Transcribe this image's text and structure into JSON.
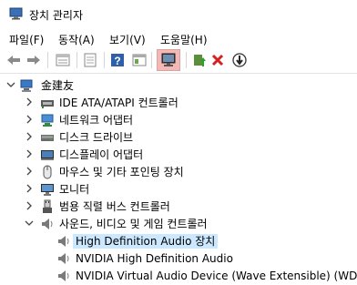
{
  "window": {
    "title": "장치 관리자"
  },
  "menu": {
    "items": [
      "파일(F)",
      "동작(A)",
      "보기(V)",
      "도움말(H)"
    ]
  },
  "toolbar": {
    "buttons": [
      "back-icon",
      "forward-icon",
      "properties-icon",
      "details-icon",
      "help-icon",
      "view-icon",
      "monitor-scan-icon",
      "update-driver-icon",
      "uninstall-icon",
      "disable-icon"
    ]
  },
  "tree": {
    "root": "金建友",
    "categories": [
      "IDE ATA/ATAPI 컨트롤러",
      "네트워크 어댑터",
      "디스크 드라이브",
      "디스플레이 어댑터",
      "마우스 및 기타 포인팅 장치",
      "모니터",
      "범용 직렬 버스 컨트롤러",
      "사운드, 비디오 및 게임 컨트롤러"
    ],
    "audio_devices": [
      "High Definition Audio 장치",
      "NVIDIA High Definition Audio",
      "NVIDIA Virtual Audio Device (Wave Extensible) (WDM)"
    ]
  },
  "colors": {
    "selection": "#cce8ff",
    "active_tool": "#f4b9b6",
    "accent": "#2a7fd4"
  }
}
